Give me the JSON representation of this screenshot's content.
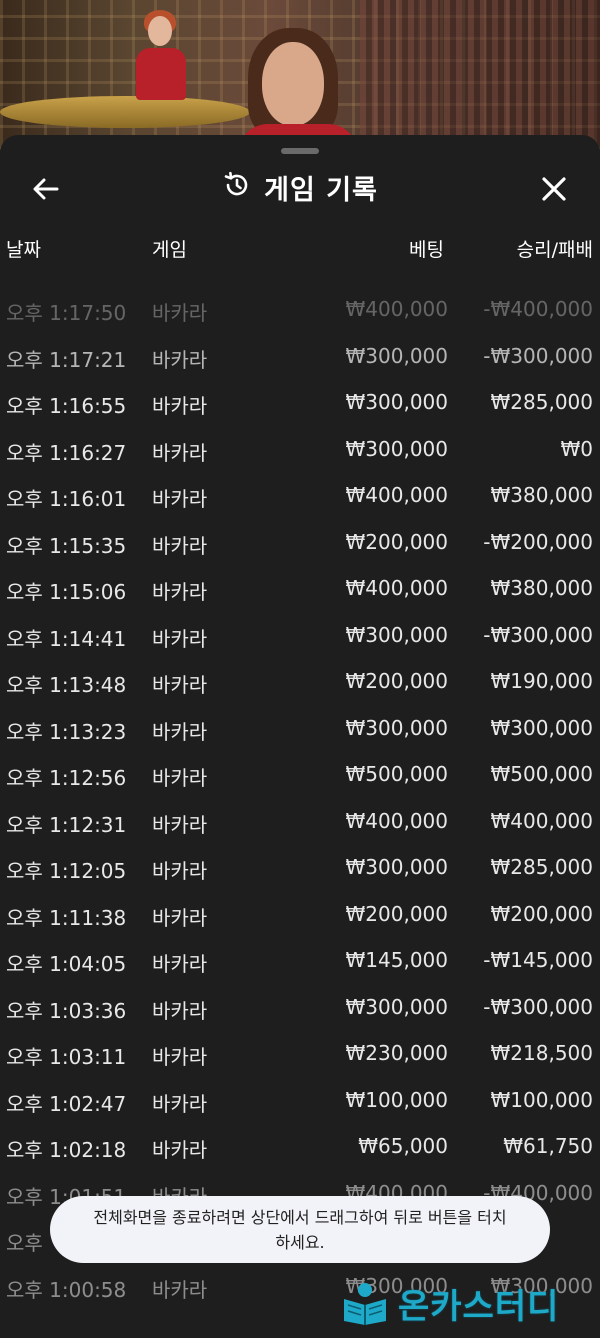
{
  "header": {
    "title": "게임 기록",
    "back_icon": "arrow-left-icon",
    "history_icon": "history-icon",
    "close_icon": "close-icon"
  },
  "columns": {
    "date": "날짜",
    "game": "게임",
    "bet": "베팅",
    "win_loss": "승리/패배"
  },
  "rows": [
    {
      "date": "오후 1:17:50",
      "game": "바카라",
      "bet": "₩400,000",
      "result": "-₩400,000"
    },
    {
      "date": "오후 1:17:21",
      "game": "바카라",
      "bet": "₩300,000",
      "result": "-₩300,000"
    },
    {
      "date": "오후 1:16:55",
      "game": "바카라",
      "bet": "₩300,000",
      "result": "₩285,000"
    },
    {
      "date": "오후 1:16:27",
      "game": "바카라",
      "bet": "₩300,000",
      "result": "₩0"
    },
    {
      "date": "오후 1:16:01",
      "game": "바카라",
      "bet": "₩400,000",
      "result": "₩380,000"
    },
    {
      "date": "오후 1:15:35",
      "game": "바카라",
      "bet": "₩200,000",
      "result": "-₩200,000"
    },
    {
      "date": "오후 1:15:06",
      "game": "바카라",
      "bet": "₩400,000",
      "result": "₩380,000"
    },
    {
      "date": "오후 1:14:41",
      "game": "바카라",
      "bet": "₩300,000",
      "result": "-₩300,000"
    },
    {
      "date": "오후 1:13:48",
      "game": "바카라",
      "bet": "₩200,000",
      "result": "₩190,000"
    },
    {
      "date": "오후 1:13:23",
      "game": "바카라",
      "bet": "₩300,000",
      "result": "₩300,000"
    },
    {
      "date": "오후 1:12:56",
      "game": "바카라",
      "bet": "₩500,000",
      "result": "₩500,000"
    },
    {
      "date": "오후 1:12:31",
      "game": "바카라",
      "bet": "₩400,000",
      "result": "₩400,000"
    },
    {
      "date": "오후 1:12:05",
      "game": "바카라",
      "bet": "₩300,000",
      "result": "₩285,000"
    },
    {
      "date": "오후 1:11:38",
      "game": "바카라",
      "bet": "₩200,000",
      "result": "₩200,000"
    },
    {
      "date": "오후 1:04:05",
      "game": "바카라",
      "bet": "₩145,000",
      "result": "-₩145,000"
    },
    {
      "date": "오후 1:03:36",
      "game": "바카라",
      "bet": "₩300,000",
      "result": "-₩300,000"
    },
    {
      "date": "오후 1:03:11",
      "game": "바카라",
      "bet": "₩230,000",
      "result": "₩218,500"
    },
    {
      "date": "오후 1:02:47",
      "game": "바카라",
      "bet": "₩100,000",
      "result": "₩100,000"
    },
    {
      "date": "오후 1:02:18",
      "game": "바카라",
      "bet": "₩65,000",
      "result": "₩61,750"
    },
    {
      "date": "오후 1:01:51",
      "game": "바카라",
      "bet": "₩400,000",
      "result": "-₩400,000"
    },
    {
      "date": "오후",
      "game": "",
      "bet": "",
      "result": ""
    },
    {
      "date": "오후 1:00:58",
      "game": "바카라",
      "bet": "₩300,000",
      "result": "₩300,000"
    }
  ],
  "toast": {
    "message": "전체화면을 종료하려면 상단에서 드래그하여 뒤로 버튼을 터치하세요."
  },
  "watermark": {
    "text": "온카스터디"
  },
  "colors": {
    "background": "#1e1e1e",
    "text": "#e8e8e8",
    "toast_bg": "#f2f3f8",
    "watermark": "#1fa9c9"
  }
}
